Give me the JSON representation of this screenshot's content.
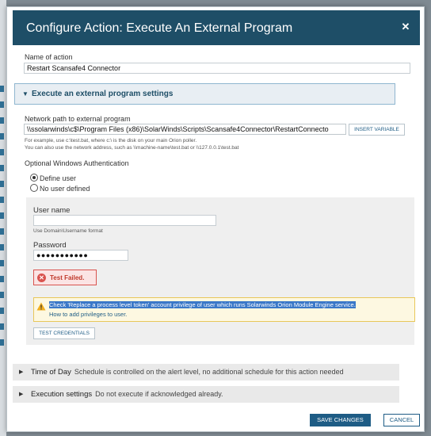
{
  "dialog": {
    "title": "Configure Action: Execute An External Program",
    "close_icon": "close-icon"
  },
  "action_name": {
    "label": "Name of action",
    "value": "Restart Scansafe4 Connector"
  },
  "program_settings": {
    "title": "Execute an external program settings",
    "path_label": "Network path to external program",
    "path_value": "\\\\ssolarwinds\\c$\\Program Files (x86)\\SolarWinds\\Scripts\\Scansafe4Connector\\RestartConnecto",
    "insert_variable": "INSERT VARIABLE",
    "hint_line1": "For example, use c:\\test.bat, where c:\\ is the disk on your main Orion poller.",
    "hint_line2": "You can also use the network address, such as \\\\machine-name\\test.bat or \\\\127.0.0.1\\test.bat"
  },
  "auth": {
    "label": "Optional Windows Authentication",
    "option_define": "Define user",
    "option_none": "No user defined",
    "selected": "Define user"
  },
  "credentials": {
    "username_label": "User name",
    "username_value": "",
    "username_hint": "Use Domain\\Username format",
    "password_label": "Password",
    "password_value": "●●●●●●●●●●●",
    "failed_text": "Test Failed.",
    "warning_line1": "Check 'Replace a process level token' account privilege of user which runs Solarwinds Orion Module Engine service.",
    "warning_line2": "How to add privileges to user.",
    "test_button": "TEST CREDENTIALS"
  },
  "time_of_day": {
    "title": "Time of Day",
    "description": "Schedule is controlled on the alert level, no additional schedule for this action needed"
  },
  "execution": {
    "title": "Execution settings",
    "description": "Do not execute if acknowledged already."
  },
  "footer": {
    "save": "SAVE CHANGES",
    "cancel": "CANCEL"
  },
  "colors": {
    "header": "#1e4e67",
    "primary": "#1e5c85",
    "error": "#d9534f",
    "warning": "#e8c75a"
  }
}
